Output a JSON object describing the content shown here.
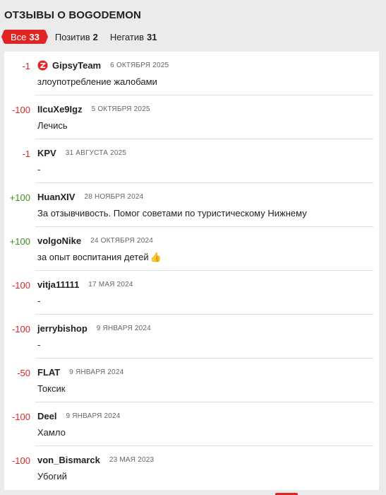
{
  "page": {
    "title": "ОТЗЫВЫ О BOGODEMON"
  },
  "tabs": [
    {
      "label": "Все",
      "count": "33"
    },
    {
      "label": "Позитив",
      "count": "2"
    },
    {
      "label": "Негатив",
      "count": "31"
    }
  ],
  "reviews": [
    {
      "score": "-1",
      "type": "neg",
      "user": "GipsyTeam",
      "date": "6 ОКТЯБРЯ 2025",
      "text": "злоупотребление жалобами",
      "avatar": "gipsyteam-logo-icon"
    },
    {
      "score": "-100",
      "type": "neg",
      "user": "IIcuXe9Igz",
      "date": "5 ОКТЯБРЯ 2025",
      "text": "Лечись"
    },
    {
      "score": "-1",
      "type": "neg",
      "user": "KPV",
      "date": "31 АВГУСТА 2025",
      "text": "-"
    },
    {
      "score": "+100",
      "type": "pos",
      "user": "HuanXIV",
      "date": "28 НОЯБРЯ 2024",
      "text": "За отзывчивость. Помог советами по туристическому Нижнему"
    },
    {
      "score": "+100",
      "type": "pos",
      "user": "volgoNike",
      "date": "24 ОКТЯБРЯ 2024",
      "text": "за опыт воспитания детей",
      "emoji": "thumbs-up-icon"
    },
    {
      "score": "-100",
      "type": "neg",
      "user": "vitja11111",
      "date": "17 МАЯ 2024",
      "text": "-"
    },
    {
      "score": "-100",
      "type": "neg",
      "user": "jerrybishop",
      "date": "9 ЯНВАРЯ 2024",
      "text": "-"
    },
    {
      "score": "-50",
      "type": "neg",
      "user": "FLAT",
      "date": "9 ЯНВАРЯ 2024",
      "text": "Токсик"
    },
    {
      "score": "-100",
      "type": "neg",
      "user": "Deel",
      "date": "9 ЯНВАРЯ 2024",
      "text": "Хамло"
    },
    {
      "score": "-100",
      "type": "neg",
      "user": "von_Bismarck",
      "date": "23 МАЯ 2023",
      "text": "Убогий"
    }
  ],
  "colors": {
    "accent": "#e02424",
    "positive": "#3d8c1e",
    "negative": "#e02424"
  }
}
